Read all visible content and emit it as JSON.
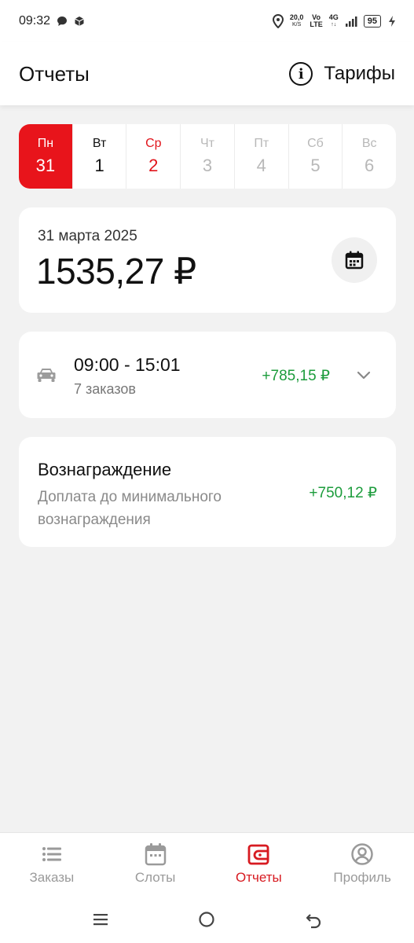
{
  "status_bar": {
    "time": "09:32",
    "net_speed_value": "20,0",
    "net_speed_unit": "K/S",
    "volte_top": "Vo",
    "volte_bottom": "LTE",
    "network": "4G",
    "battery": "95"
  },
  "header": {
    "title": "Отчеты",
    "tariffs_label": "Тарифы"
  },
  "week": [
    {
      "name": "Пн",
      "date": "31"
    },
    {
      "name": "Вт",
      "date": "1"
    },
    {
      "name": "Ср",
      "date": "2"
    },
    {
      "name": "Чт",
      "date": "3"
    },
    {
      "name": "Пт",
      "date": "4"
    },
    {
      "name": "Сб",
      "date": "5"
    },
    {
      "name": "Вс",
      "date": "6"
    }
  ],
  "summary": {
    "date": "31 марта 2025",
    "amount": "1535,27 ₽"
  },
  "shift": {
    "time_range": "09:00 - 15:01",
    "orders": "7 заказов",
    "amount": "+785,15 ₽"
  },
  "reward": {
    "title": "Вознаграждение",
    "description": "Доплата до минимального вознаграждения",
    "amount": "+750,12 ₽"
  },
  "bottom_nav": [
    {
      "label": "Заказы"
    },
    {
      "label": "Слоты"
    },
    {
      "label": "Отчеты"
    },
    {
      "label": "Профиль"
    }
  ],
  "colors": {
    "accent": "#e8141b",
    "positive": "#1c9c3c",
    "muted": "#9a9a9a",
    "background": "#f2f2f2"
  }
}
